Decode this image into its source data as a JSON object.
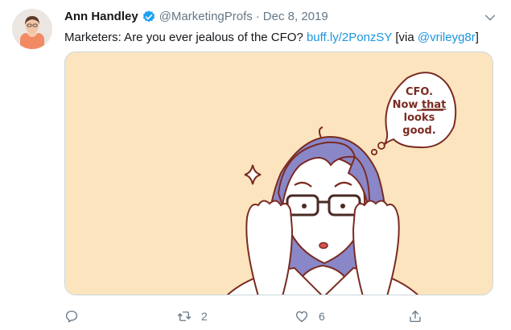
{
  "tweet": {
    "author_name": "Ann Handley",
    "handle": "@MarketingProfs",
    "separator": "·",
    "date": "Dec 8, 2019",
    "text_before": "Marketers: Are you ever jealous of the CFO? ",
    "link": "buff.ly/2PonzSY",
    "text_mid": " [via ",
    "mention": "@vrileyg8r",
    "text_after": "]"
  },
  "media": {
    "speech_line1": "CFO.",
    "speech_line2_a": "Now ",
    "speech_line2_b": "that",
    "speech_line3": "looks",
    "speech_line4": "good.",
    "background_color": "#fbe4be"
  },
  "actions": {
    "reply_count": "",
    "retweet_count": "2",
    "like_count": "6"
  },
  "colors": {
    "text": "#14171a",
    "secondary": "#657786",
    "link": "#1b95e0",
    "verified": "#1da1f2"
  },
  "icons": {
    "verified": "verified-badge-icon",
    "caret": "chevron-down-icon",
    "reply": "reply-icon",
    "retweet": "retweet-icon",
    "like": "heart-icon",
    "share": "share-icon"
  }
}
